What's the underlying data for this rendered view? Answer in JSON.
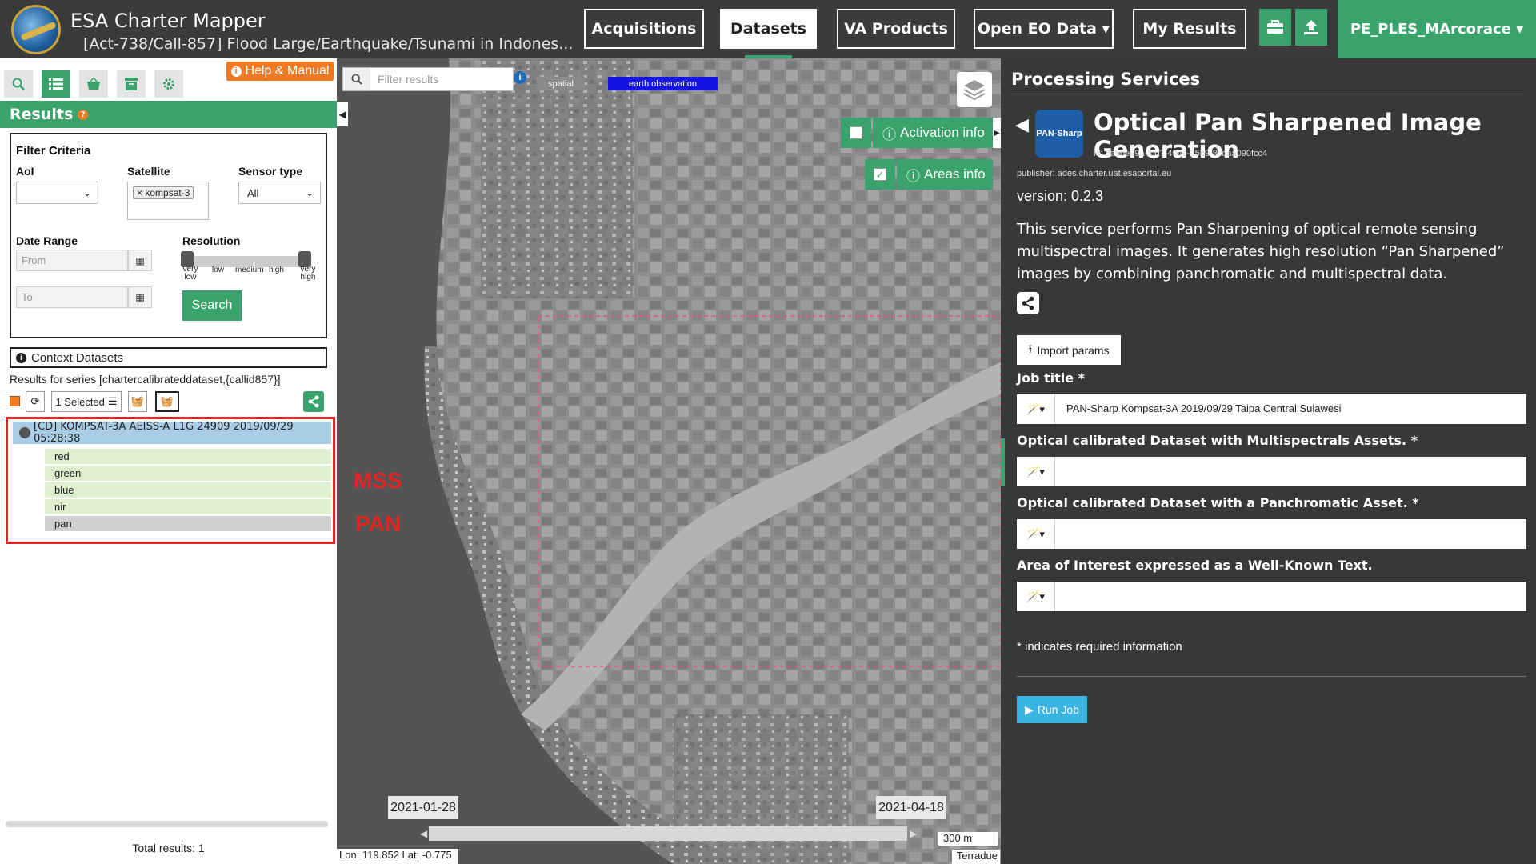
{
  "header": {
    "app_title": "ESA Charter Mapper",
    "activation_title": "[Act-738/Call-857] Flood Large/Earthquake/Tsunami in Indones...",
    "nav": [
      "Acquisitions",
      "Datasets",
      "VA Products",
      "Open EO Data ▾",
      "My Results"
    ],
    "active_nav": "Datasets",
    "user": "PE_PLES_MArcorace ▾"
  },
  "left": {
    "help": "Help & Manual",
    "results_title": "Results",
    "filter": {
      "title": "Filter Criteria",
      "aoi_label": "AoI",
      "satellite_label": "Satellite",
      "satellite_value": "kompsat-3",
      "sensor_label": "Sensor type",
      "sensor_value": "All",
      "date_label": "Date Range",
      "from_placeholder": "From",
      "to_placeholder": "To",
      "resolution_label": "Resolution",
      "resolution_ticks": [
        "very low",
        "low",
        "medium",
        "high",
        "very high"
      ],
      "search_label": "Search"
    },
    "context_label": "Context Datasets",
    "series_text": "Results for series [chartercalibrateddataset,{callid857}]",
    "selected_label": "1 Selected",
    "result_title": "[CD] KOMPSAT-3A AEISS-A L1G 24909 2019/09/29 05:28:38",
    "assets": [
      "red",
      "green",
      "blue",
      "nir",
      "pan"
    ],
    "total": "Total results: 1"
  },
  "map": {
    "filter_placeholder": "Filter results",
    "tags": [
      "spatial",
      "earth observation"
    ],
    "activation_info": "Activation info",
    "areas_info": "Areas info",
    "note_mss": "MSS",
    "note_pan": "PAN",
    "date_start": "2021-01-28",
    "date_end": "2021-04-18",
    "scale": "300 m",
    "coords": "Lon: 119.852 Lat: -0.775",
    "attribution": "Terradue"
  },
  "right": {
    "panel_title": "Processing Services",
    "logo_text": "PAN-Sharp",
    "service_name": "Optical Pan Sharpened Image Generation",
    "service_id": "id: 8a9be99a-fbd7-494e-85b9-8cdaa090fcc4",
    "publisher": "publisher: ades.charter.uat.esaportal.eu",
    "version": "version: 0.2.3",
    "description": "This service performs Pan Sharpening of optical remote sensing multispectral images. It generates high resolution “Pan Sharpened” images by combining panchromatic and multispectral data.",
    "import_label": "Import params",
    "fields": [
      {
        "label": "Job title *",
        "value": "PAN-Sharp Kompsat-3A 2019/09/29 Taipa Central Sulawesi"
      },
      {
        "label": "Optical calibrated Dataset with Multispectrals Assets. *",
        "value": ""
      },
      {
        "label": "Optical calibrated Dataset with a Panchromatic Asset. *",
        "value": ""
      },
      {
        "label": "Area of Interest expressed as a Well-Known Text.",
        "value": ""
      }
    ],
    "required_note": "* indicates required information",
    "run_label": "Run Job"
  },
  "colors": {
    "green": "#3aa36b",
    "orange": "#f07a22",
    "red": "#e02525",
    "blue": "#3ab4e0"
  }
}
